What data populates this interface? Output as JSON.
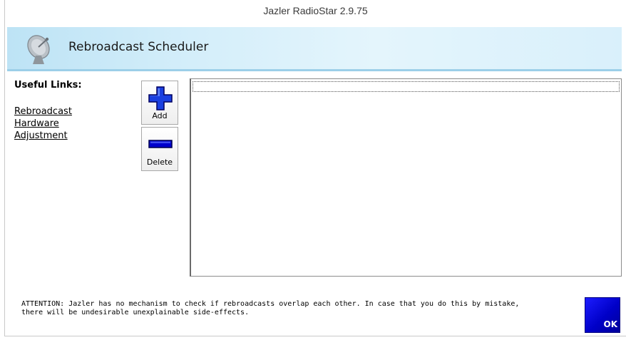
{
  "window": {
    "title": "Jazler RadioStar 2.9.75"
  },
  "header": {
    "title": "Rebroadcast Scheduler",
    "icon": "satellite-dish-icon"
  },
  "sidebar": {
    "links_title": "Useful Links:",
    "links": [
      "Rebroadcast",
      "Hardware",
      "Adjustment"
    ]
  },
  "toolbar": {
    "add_label": "Add",
    "delete_label": "Delete"
  },
  "notice": {
    "line1": "ATTENTION: Jazler has no mechanism to check if rebroadcasts overlap each other. In case that you do this by mistake,",
    "line2": "there will be undesirable unexplainable side-effects."
  },
  "footer": {
    "ok_label": "OK"
  },
  "colors": {
    "header_gradient_start": "#bde3f5",
    "add_icon": "#0033cc",
    "delete_icon": "#0000cc",
    "ok_button": "#0000c8"
  }
}
